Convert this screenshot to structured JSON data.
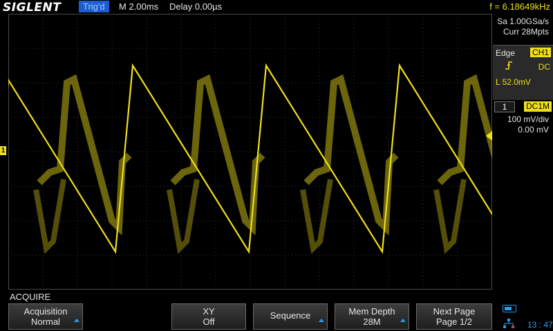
{
  "header": {
    "logo": "SIGLENT",
    "status": "Trig'd",
    "timebase": "M 2.00ms",
    "delay": "Delay 0.00µs",
    "frequency": "f = 6.18649kHz"
  },
  "acquisition_info": {
    "sample_rate": "Sa 1.00GSa/s",
    "memory": "Curr 28Mpts"
  },
  "trigger": {
    "type": "Edge",
    "source": "CH1",
    "slope_icon": "rising-edge-icon",
    "coupling": "DC",
    "level": "L  52.0mV"
  },
  "channel": {
    "number": "1",
    "impedance": "DC1M",
    "scale": "100 mV/div",
    "offset": "0.00 mV",
    "marker": "1",
    "color": "#f0e01a"
  },
  "menu": {
    "title": "ACQUIRE",
    "softkeys": [
      {
        "line1": "Acquisition",
        "line2": "Normal"
      },
      {
        "line1": "XY",
        "line2": "Off"
      },
      {
        "line1": "Sequence",
        "line2": ""
      },
      {
        "line1": "Mem Depth",
        "line2": "28M"
      },
      {
        "line1": "Next Page",
        "line2": "Page 1/2"
      }
    ]
  },
  "status_bar": {
    "clock": "13 : 47",
    "usb_icon": "usb-icon",
    "network_icon": "network-icon"
  },
  "colors": {
    "trace": "#f0e01a",
    "accent": "#2c9be8",
    "status_bg": "#1d5bd1"
  }
}
